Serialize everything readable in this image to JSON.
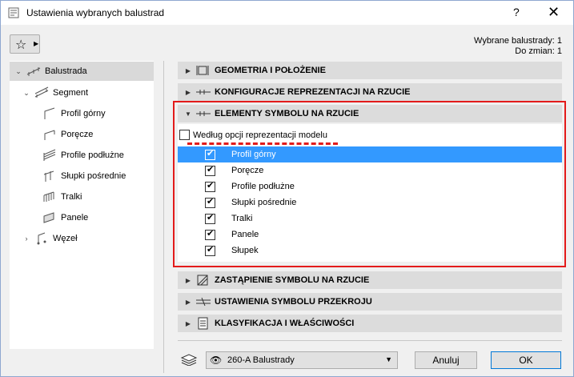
{
  "window": {
    "title": "Ustawienia wybranych balustrad",
    "help_label": "?",
    "close_label": "✕"
  },
  "header": {
    "selected_count": "Wybrane balustrady: 1",
    "edit_count": "Do zmian: 1"
  },
  "tree": {
    "items": [
      {
        "label": "Balustrada",
        "chevron": "⌄"
      },
      {
        "label": "Segment",
        "chevron": "⌄"
      },
      {
        "label": "Profil górny"
      },
      {
        "label": "Poręcze"
      },
      {
        "label": "Profile podłużne"
      },
      {
        "label": "Słupki pośrednie"
      },
      {
        "label": "Tralki"
      },
      {
        "label": "Panele"
      },
      {
        "label": "Węzeł",
        "chevron": "›"
      }
    ]
  },
  "sections": [
    {
      "label": "GEOMETRIA I POŁOŻENIE",
      "arrow": "▶"
    },
    {
      "label": "KONFIGURACJE REPREZENTACJI NA RZUCIE",
      "arrow": "▶"
    },
    {
      "label": "ELEMENTY SYMBOLU NA RZUCIE",
      "arrow": "▼"
    },
    {
      "label": "ZASTĄPIENIE SYMBOLU NA RZUCIE",
      "arrow": "▶"
    },
    {
      "label": "USTAWIENIA SYMBOLU PRZEKROJU",
      "arrow": "▶"
    },
    {
      "label": "KLASYFIKACJA I WŁAŚCIWOŚCI",
      "arrow": "▶"
    }
  ],
  "symbol_elements": {
    "model_option_label": "Według opcji reprezentacji modelu",
    "model_option_checked": false,
    "items": [
      {
        "label": "Profil górny",
        "checked": true,
        "selected": true
      },
      {
        "label": "Poręcze",
        "checked": true,
        "selected": false
      },
      {
        "label": "Profile podłużne",
        "checked": true,
        "selected": false
      },
      {
        "label": "Słupki pośrednie",
        "checked": true,
        "selected": false
      },
      {
        "label": "Tralki",
        "checked": true,
        "selected": false
      },
      {
        "label": "Panele",
        "checked": true,
        "selected": false
      },
      {
        "label": "Słupek",
        "checked": true,
        "selected": false
      }
    ]
  },
  "footer": {
    "layer_value": "260-A Balustrady",
    "cancel_label": "Anuluj",
    "ok_label": "OK"
  },
  "colors": {
    "selection": "#3399ff",
    "highlight_frame": "#e31b1b",
    "section_header": "#dcdcdc"
  }
}
